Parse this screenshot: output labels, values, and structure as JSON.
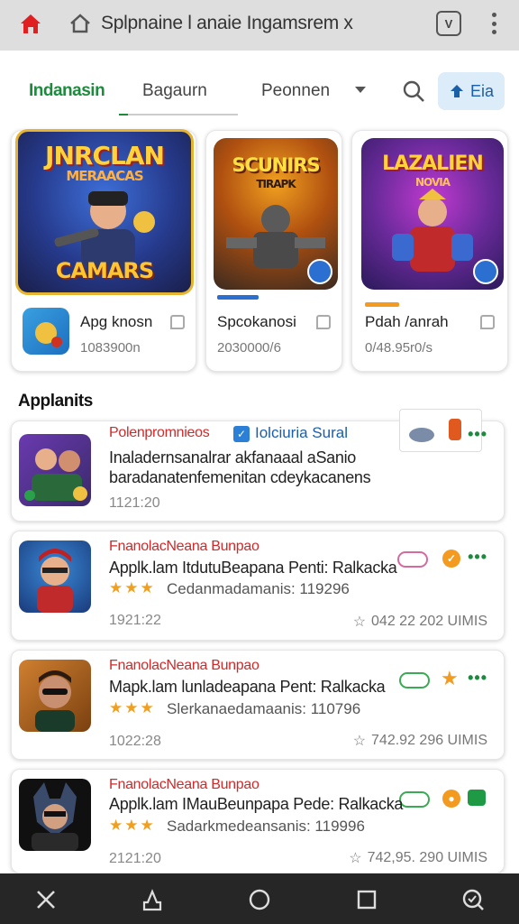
{
  "browser": {
    "url_text": "Splpnaine l anaie Ingamsrem x",
    "tab_count": "V"
  },
  "nav": {
    "tabs": [
      {
        "label": "Indanasin",
        "active": true
      },
      {
        "label": "Bagaurn",
        "active": false
      },
      {
        "label": "Peonnen",
        "active": false
      }
    ],
    "action_label": "Eia"
  },
  "featured": [
    {
      "art_title_top": "JNRCLAN",
      "art_title_sub": "MERAACAS",
      "art_title_bottom": "CAMARS",
      "title": "Apg knosn",
      "subtitle": "1083900n"
    },
    {
      "art_title_top": "SCUNIRS",
      "art_title_sub": "TIRAPK",
      "art_title_bottom": "",
      "title": "Spcokanosi",
      "subtitle": "2030000/6"
    },
    {
      "art_title_top": "LAZALIEN",
      "art_title_sub": "NOVIA",
      "art_title_bottom": "",
      "title": "Pdah /anrah",
      "subtitle": "0/48.95r0/s"
    }
  ],
  "section_title": "Applanits",
  "list": [
    {
      "title": "Polenpromnieos",
      "link": "Iolciuria Sural",
      "line1": "Inaladernsanalrar akfanaaal aSanio",
      "line2": "baradanatenfemenitan cdeykacanens",
      "date": "1121:20"
    },
    {
      "title": "FnanolacNeana Bunpao",
      "line1": "Applk.lam ItdutuBeapana Penti: Ralkacka",
      "stars": "★★★",
      "line2": "Cedanmadamanis: 119296",
      "date": "1921:22",
      "stat": "042 22 202 UIMIS"
    },
    {
      "title": "FnanolacNeana Bunpao",
      "line1": "Mapk.lam lunladeapana Pent: Ralkacka",
      "stars": "★★★",
      "line2": "Slerkanaedamaanis: 110796",
      "date": "1022:28",
      "stat": "742.92 296 UIMIS"
    },
    {
      "title": "FnanolacNeana Bunpao",
      "line1": "Applk.lam IMauBeunpapa Pede: Ralkacka",
      "stars": "★★★",
      "line2": "Sadarkmedeansanis: 119996",
      "date": "2121:20",
      "stat": "742,95. 290 UIMIS"
    }
  ],
  "colors": {
    "accent_green": "#1e8a3e",
    "accent_red": "#d02a2a",
    "accent_blue": "#1a5faa",
    "star": "#f0a020"
  }
}
